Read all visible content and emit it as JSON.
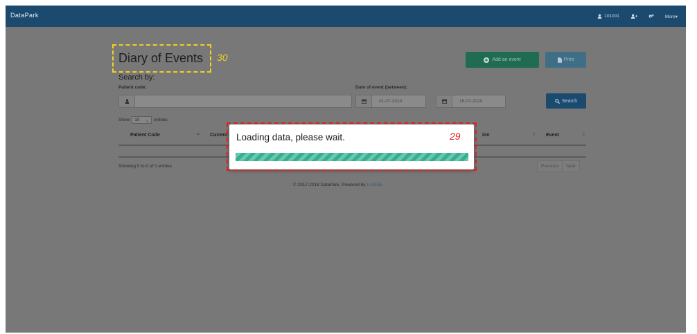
{
  "navbar": {
    "brand": "DataPark",
    "user": "101001",
    "more": "More▾",
    "icons": [
      "user-icon",
      "user-plus-icon",
      "cogs-icon"
    ]
  },
  "page": {
    "title": "Diary of Events",
    "add_event_label": "Add an event",
    "print_label": "Print",
    "search_by": "Search by:",
    "patient_code_label": "Patient code:",
    "patient_code_value": "",
    "date_label": "Date of event (between):",
    "date_from": "01-07-2010",
    "date_to": "16-07-2020",
    "search_label": "Search"
  },
  "table": {
    "show_prefix": "Show",
    "show_value": "10",
    "show_suffix": "entries",
    "columns": [
      "Patient Code",
      "Current R",
      "ion",
      "Event"
    ],
    "info": "Showing 0 to 0 of 0 entries",
    "previous": "Previous",
    "next": "Next"
  },
  "footer": {
    "text": "© 2017-2018 DataPark, Powered by",
    "link": "LASIGE"
  },
  "modal": {
    "message": "Loading data, please wait.",
    "progress": 1.0
  },
  "annotations": {
    "title_marker": "30",
    "modal_marker": "29"
  },
  "colors": {
    "navbar": "#1c4a6e",
    "overlay": "#787878",
    "add_button": "#1f6c52",
    "print_button": "#3f6f87",
    "search_button": "#1b4a6f",
    "progress": "#33b08f",
    "marker_yellow": "#f2d21c",
    "marker_red": "#e0201c"
  }
}
